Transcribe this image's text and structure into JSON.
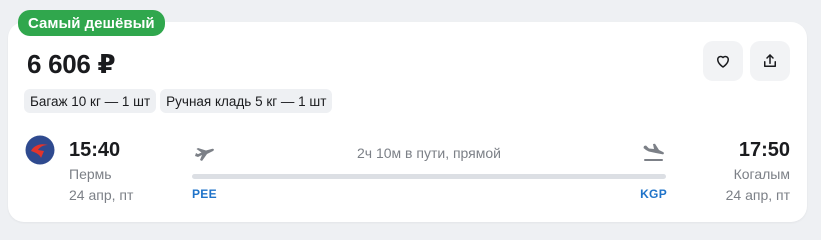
{
  "badge": {
    "label": "Самый дешёвый",
    "color": "#30a74d"
  },
  "price": {
    "amount": "6 606 ₽"
  },
  "actions": {
    "favorite_icon": "heart-icon",
    "share_icon": "share-icon"
  },
  "baggage": [
    {
      "label": "Багаж 10 кг — 1 шт"
    },
    {
      "label": "Ручная кладь 5 кг — 1 шт"
    }
  ],
  "airline": {
    "logo_icon": "airline-logo-icon",
    "brand_colors": [
      "#2f4a8f",
      "#e2342b"
    ]
  },
  "departure": {
    "time": "15:40",
    "city": "Пермь",
    "date": "24 апр, пт",
    "iata": "PEE"
  },
  "arrival": {
    "time": "17:50",
    "city": "Когалым",
    "date": "24 апр, пт",
    "iata": "KGP"
  },
  "flight": {
    "duration_text": "2ч 10м в пути, прямой"
  },
  "colors": {
    "accent_link": "#1f73c9",
    "muted_text": "#7c8087"
  }
}
